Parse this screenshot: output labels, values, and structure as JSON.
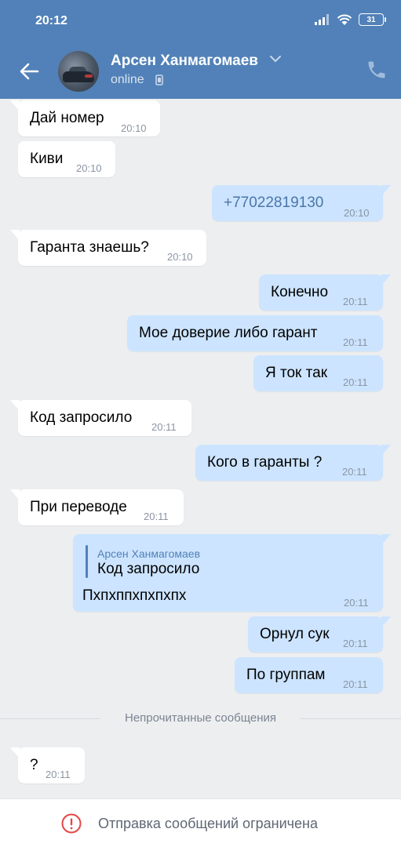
{
  "status_bar": {
    "time": "20:12",
    "battery": "31"
  },
  "header": {
    "contact_name": "Арсен Ханмагомаев",
    "status": "online"
  },
  "messages": [
    {
      "dir": "in",
      "text": "Дай номер",
      "time": "20:10"
    },
    {
      "dir": "in",
      "text": "Киви",
      "time": "20:10"
    },
    {
      "dir": "out",
      "text": "+77022819130",
      "time": "20:10"
    },
    {
      "dir": "in",
      "text": "Гаранта знаешь?",
      "time": "20:10"
    },
    {
      "dir": "out",
      "text": "Конечно",
      "time": "20:11"
    },
    {
      "dir": "out",
      "text": "Мое доверие либо гарант",
      "time": "20:11"
    },
    {
      "dir": "out",
      "text": "Я ток так",
      "time": "20:11"
    },
    {
      "dir": "in",
      "text": "Код запросило",
      "time": "20:11"
    },
    {
      "dir": "out",
      "text": "Кого в гаранты ?",
      "time": "20:11"
    },
    {
      "dir": "in",
      "text": "При переводе",
      "time": "20:11"
    },
    {
      "dir": "out",
      "reply_author": "Арсен Ханмагомаев",
      "reply_text": "Код запросило",
      "text": "Пхпхппхпхпхпх",
      "time": "20:11"
    },
    {
      "dir": "out",
      "text": "Орнул сук",
      "time": "20:11"
    },
    {
      "dir": "out",
      "text": "По группам",
      "time": "20:11"
    },
    {
      "dir": "in",
      "text": "?",
      "time": "20:11"
    }
  ],
  "unread_divider": "Непрочитанные сообщения",
  "bottom_notice": "Отправка сообщений ограничена",
  "colors": {
    "accent": "#5181b8",
    "outgoing": "#cce4ff",
    "incoming": "#ffffff",
    "background": "#edeef0",
    "warning": "#e64646"
  },
  "icons": [
    "back-arrow-icon",
    "chevron-down-icon",
    "mobile-phone-icon",
    "call-icon",
    "signal-icon",
    "wifi-icon",
    "battery-icon",
    "warning-icon"
  ]
}
